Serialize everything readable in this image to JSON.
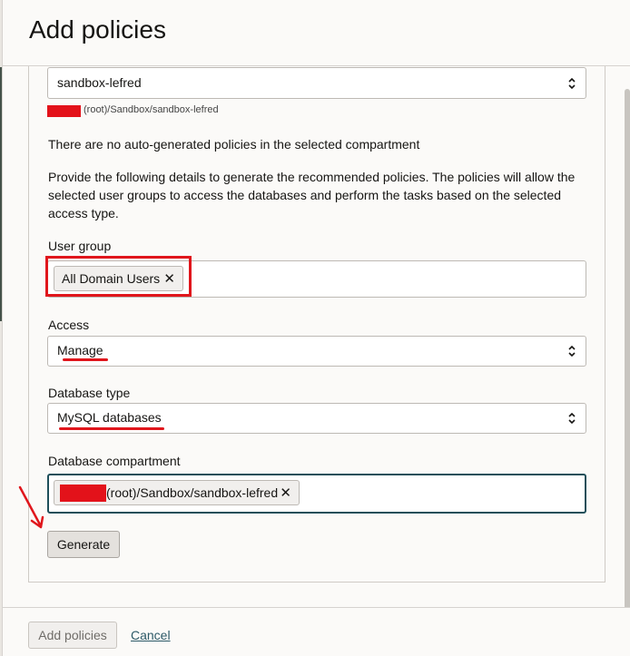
{
  "dialog": {
    "title": "Add policies"
  },
  "compartment": {
    "selected": "sandbox-lefred",
    "path": "(root)/Sandbox/sandbox-lefred"
  },
  "messages": {
    "no_policies": "There are no auto-generated policies in the selected compartment",
    "instructions": "Provide the following details to generate the recommended policies. The policies will allow the selected user groups to access the databases and perform the tasks based on the selected access type."
  },
  "user_group": {
    "label": "User group",
    "chips": [
      "All Domain Users"
    ]
  },
  "access": {
    "label": "Access",
    "value": "Manage"
  },
  "database_type": {
    "label": "Database type",
    "value": "MySQL databases"
  },
  "database_compartment": {
    "label": "Database compartment",
    "chip_path": "(root)/Sandbox/sandbox-lefred"
  },
  "actions": {
    "generate_label": "Generate",
    "add_policies_label": "Add policies",
    "cancel_label": "Cancel"
  },
  "icons": {
    "select_chevron": "chevron-up-down-icon",
    "chip_remove": "close-icon",
    "annotation_arrow": "arrow-icon"
  },
  "colors": {
    "annotation_red": "#e0161c",
    "redaction_red": "#e3121a",
    "focus_border": "#1e4f5a",
    "link": "#2c5967"
  }
}
